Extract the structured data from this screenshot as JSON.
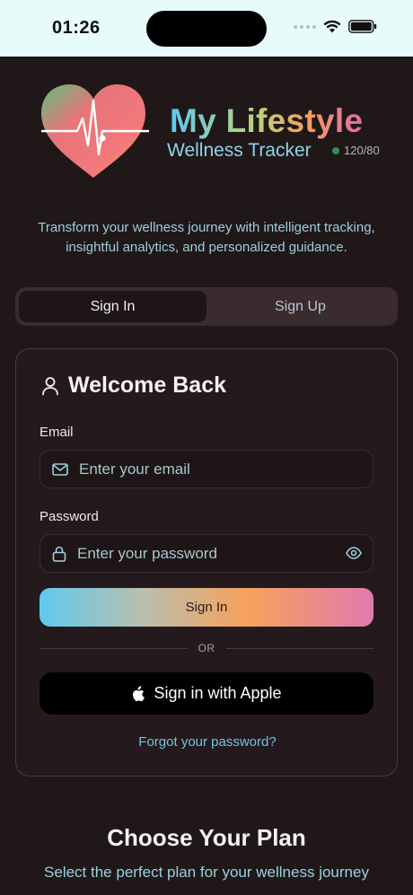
{
  "status_bar": {
    "time": "01:26"
  },
  "brand": {
    "title": "My Lifestyle",
    "subtitle": "Wellness Tracker",
    "bp_reading": "120/80",
    "tagline": "Transform your wellness journey with intelligent tracking, insightful analytics, and personalized guidance."
  },
  "tabs": [
    {
      "label": "Sign In",
      "active": true
    },
    {
      "label": "Sign Up",
      "active": false
    }
  ],
  "form": {
    "title": "Welcome Back",
    "email_label": "Email",
    "email_placeholder": "Enter your email",
    "password_label": "Password",
    "password_placeholder": "Enter your password",
    "signin_label": "Sign In",
    "or_label": "OR",
    "apple_label": "Sign in with Apple",
    "forgot_label": "Forgot your password?"
  },
  "plans": {
    "title": "Choose Your Plan",
    "subtitle": "Select the perfect plan for your wellness journey"
  },
  "colors": {
    "background": "#201719",
    "accent_blue": "#5ecbee",
    "accent_orange": "#f6a25c",
    "accent_pink": "#e07ab0"
  }
}
